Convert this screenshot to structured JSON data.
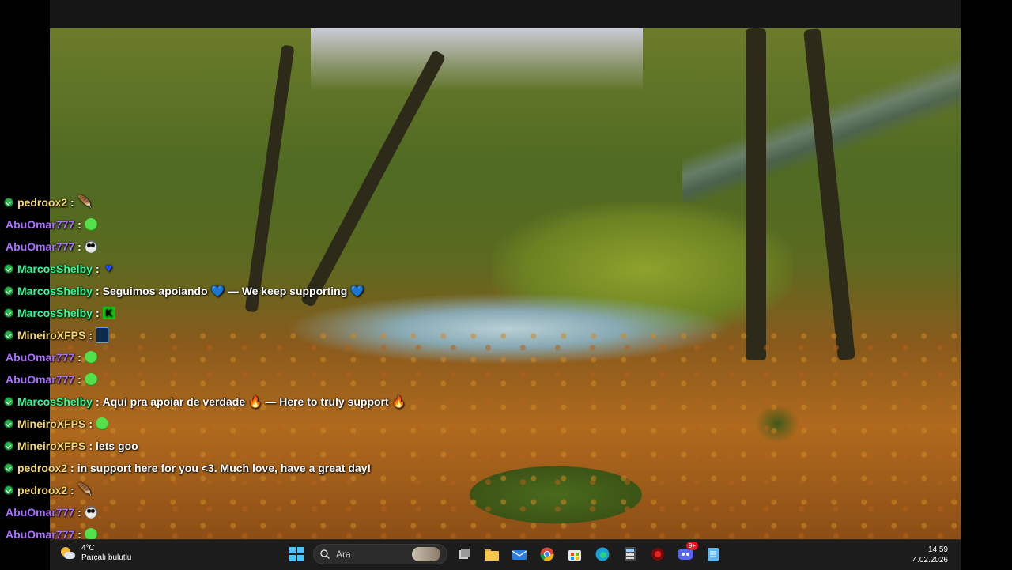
{
  "chat": {
    "messages": [
      {
        "user": "pedroox2",
        "color": "#f5d76e",
        "badge": true,
        "text": "",
        "emotes": [
          "feather-icon"
        ]
      },
      {
        "user": "AbuOmar777",
        "color": "#a970ff",
        "badge": false,
        "text": "",
        "emotes": [
          "green-face-icon"
        ]
      },
      {
        "user": "AbuOmar777",
        "color": "#a970ff",
        "badge": false,
        "text": "",
        "emotes": [
          "panda-icon"
        ]
      },
      {
        "user": "MarcosShelby",
        "color": "#2dff99",
        "badge": true,
        "text": "",
        "emotes": [
          "blue-heart-icon"
        ]
      },
      {
        "user": "MarcosShelby",
        "color": "#2dff99",
        "badge": true,
        "text": "Seguimos apoiando 💙 — We keep supporting 💙",
        "emotes": []
      },
      {
        "user": "MarcosShelby",
        "color": "#2dff99",
        "badge": true,
        "text": "",
        "emotes": [
          "k-icon"
        ]
      },
      {
        "user": "MineiroXFPS",
        "color": "#f5d76e",
        "badge": true,
        "text": "",
        "emotes": [
          "card-icon"
        ]
      },
      {
        "user": "AbuOmar777",
        "color": "#a970ff",
        "badge": false,
        "text": "",
        "emotes": [
          "green-face-icon"
        ]
      },
      {
        "user": "AbuOmar777",
        "color": "#a970ff",
        "badge": false,
        "text": "",
        "emotes": [
          "green-face-icon"
        ]
      },
      {
        "user": "MarcosShelby",
        "color": "#2dff99",
        "badge": true,
        "text": "Aqui pra apoiar de verdade 🔥 — Here to truly support 🔥",
        "emotes": []
      },
      {
        "user": "MineiroXFPS",
        "color": "#f5d76e",
        "badge": true,
        "text": "",
        "emotes": [
          "green-face-icon"
        ]
      },
      {
        "user": "MineiroXFPS",
        "color": "#f5d76e",
        "badge": true,
        "text": "lets goo",
        "emotes": []
      },
      {
        "user": "pedroox2",
        "color": "#f5d76e",
        "badge": true,
        "text": "in support here for you <3. Much love, have a great day!",
        "emotes": []
      },
      {
        "user": "pedroox2",
        "color": "#f5d76e",
        "badge": true,
        "text": "",
        "emotes": [
          "feather-icon"
        ]
      },
      {
        "user": "AbuOmar777",
        "color": "#a970ff",
        "badge": false,
        "text": "",
        "emotes": [
          "panda-icon"
        ]
      },
      {
        "user": "AbuOmar777",
        "color": "#a970ff",
        "badge": false,
        "text": "",
        "emotes": [
          "green-face-icon"
        ]
      }
    ]
  },
  "taskbar": {
    "weather": {
      "temp": "4°C",
      "condition": "Parçalı bulutlu"
    },
    "search_placeholder": "Ara",
    "discord_badge": "9+",
    "time": "14:59",
    "date": "4.02.2026"
  }
}
